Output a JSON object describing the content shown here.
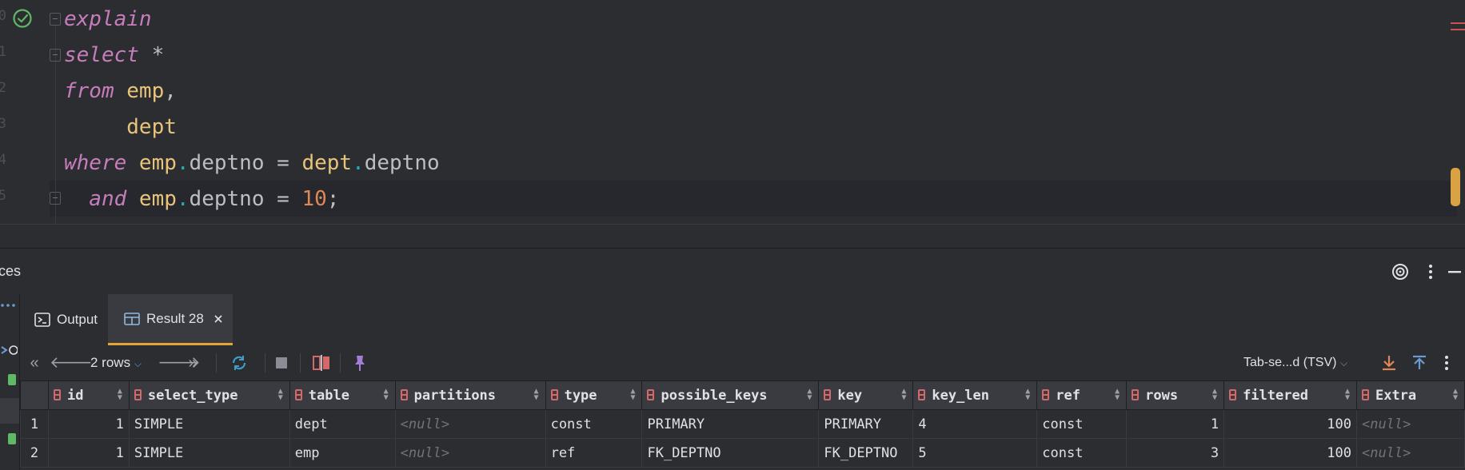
{
  "editor": {
    "line_numbers": [
      "0",
      "1",
      "2",
      "3",
      "4",
      "5"
    ],
    "lines": [
      [
        {
          "t": "explain",
          "c": "kw"
        }
      ],
      [
        {
          "t": "select ",
          "c": "kw"
        },
        {
          "t": "*",
          "c": "op"
        }
      ],
      [
        {
          "t": "from ",
          "c": "kw"
        },
        {
          "t": "emp",
          "c": "tbl"
        },
        {
          "t": ",",
          "c": "plain"
        }
      ],
      [
        {
          "t": "     dept",
          "c": "tbl"
        }
      ],
      [
        {
          "t": "where ",
          "c": "kw"
        },
        {
          "t": "emp",
          "c": "tbl"
        },
        {
          "t": ".",
          "c": "dot"
        },
        {
          "t": "deptno = ",
          "c": "plain"
        },
        {
          "t": "dept",
          "c": "tbl"
        },
        {
          "t": ".",
          "c": "dot"
        },
        {
          "t": "deptno",
          "c": "plain"
        }
      ],
      [
        {
          "t": "  and ",
          "c": "kw"
        },
        {
          "t": "emp",
          "c": "tbl"
        },
        {
          "t": ".",
          "c": "dot"
        },
        {
          "t": "deptno = ",
          "c": "plain"
        },
        {
          "t": "10",
          "c": "num2"
        },
        {
          "t": ";",
          "c": "plain"
        }
      ]
    ]
  },
  "services": {
    "title": "ces",
    "icons": [
      "target-icon",
      "more-vertical-icon",
      "minimize-icon"
    ]
  },
  "tabs": [
    {
      "label": "Output",
      "icon": "console-icon",
      "active": false
    },
    {
      "label": "Result 28",
      "icon": "table-icon",
      "active": true,
      "closable": true
    }
  ],
  "toolbar": {
    "rows_label": "2 rows",
    "export_format": "Tab-se...d (TSV)"
  },
  "grid": {
    "columns": [
      "id",
      "select_type",
      "table",
      "partitions",
      "type",
      "possible_keys",
      "key",
      "key_len",
      "ref",
      "rows",
      "filtered",
      "Extra"
    ],
    "rows": [
      [
        "1",
        "1",
        "SIMPLE",
        "dept",
        "<null>",
        "const",
        "PRIMARY",
        "PRIMARY",
        "4",
        "const",
        "1",
        "100",
        "<null>"
      ],
      [
        "2",
        "1",
        "SIMPLE",
        "emp",
        "<null>",
        "ref",
        "FK_DEPTNO",
        "FK_DEPTNO",
        "5",
        "const",
        "3",
        "100",
        "<null>"
      ]
    ]
  },
  "colors": {
    "accent": "#e5a336",
    "keyword": "#c77dbb",
    "table_name": "#e8c47a",
    "number": "#e08855",
    "success_check": "#5fb865"
  }
}
